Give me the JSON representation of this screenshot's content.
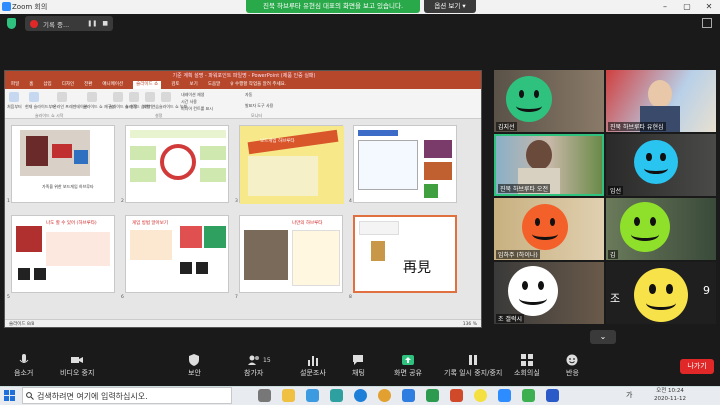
{
  "window": {
    "title": "Zoom 회의",
    "controls": [
      "–",
      "▢",
      "✕"
    ]
  },
  "share_banner": {
    "text": "진북 하브루타 유현심 대표의 화면을 보고 있습니다.",
    "view_options": "옵션 보기 ▾"
  },
  "meeting_header": {
    "recording_label": "기록 중...",
    "pause_icon": "❚❚",
    "stop_icon": "■"
  },
  "powerpoint": {
    "title": "기준 계획 설명 - 파워포인트 파일명 - PowerPoint (제품 인증 실패)",
    "tabs": [
      "파일",
      "홈",
      "삽입",
      "디자인",
      "전환",
      "애니메이션",
      "슬라이드 쇼",
      "검토",
      "보기",
      "도움말",
      "♀ 수행할 작업을 알려 주세요."
    ],
    "active_tab": "슬라이드 쇼",
    "ribbon_buttons": [
      "처음부터",
      "현재 슬라이드부터",
      "온라인 프레젠테이션",
      "슬라이드 쇼 재구성",
      "슬라이드 쇼 설정",
      "슬라이드 숨기기",
      "예행 연습",
      "슬라이드 쇼 녹화"
    ],
    "ribbon_checks": [
      "내레이션 재생",
      "시간 사용",
      "미디어 컨트롤 표시"
    ],
    "ribbon_groups": [
      "슬라이드 쇼 시작",
      "설정",
      "모니터"
    ],
    "monitor_select": "자동",
    "presenter_view": "발표자 도구 사용",
    "slide_numbers": [
      "1",
      "2",
      "3",
      "4",
      "5",
      "6",
      "7",
      "8"
    ],
    "selected_slide": "8",
    "slide_texts": {
      "s1_caption": "가족을 위한 보드게임 하브루타",
      "s3_title": "보드게임 하브루타",
      "s5_title": "나도 할 수 있어 (하브루타)",
      "s6_title": "게임 방법 알아보기",
      "s7_title": "나만의 하브루타",
      "s8_char": "再見"
    },
    "status_left": "슬라이드 8/8",
    "status_right": "136 %"
  },
  "participants": [
    {
      "name": "김지선",
      "smiley": "#2ec27e"
    },
    {
      "name": "진북 하브루타 유현심",
      "smiley": null
    },
    {
      "name": "진북 하브루타 오전",
      "smiley": null
    },
    {
      "name": "임선",
      "smiley": "#29c4f0"
    },
    {
      "name": "임하주 (하이나)",
      "smiley": "#f4602a"
    },
    {
      "name": "김",
      "smiley": "#8fe02a"
    },
    {
      "name": "조 갤럭시",
      "smiley": "#ffffff"
    },
    {
      "name": "조",
      "smiley": "#f8e24a"
    }
  ],
  "tile_number": "9",
  "grid_more": "⌄",
  "toolbar": {
    "items": [
      {
        "label": "음소거",
        "icon": "microphone-icon"
      },
      {
        "label": "비디오 중지",
        "icon": "video-icon"
      },
      {
        "label": "보안",
        "icon": "shield-icon"
      },
      {
        "label": "참가자",
        "icon": "participants-icon",
        "count": "15"
      },
      {
        "label": "설문조사",
        "icon": "poll-icon"
      },
      {
        "label": "채팅",
        "icon": "chat-icon"
      },
      {
        "label": "화면 공유",
        "icon": "share-screen-icon"
      },
      {
        "label": "기록 일시 중지/중지",
        "icon": "pause-record-icon"
      },
      {
        "label": "소회의실",
        "icon": "breakout-icon"
      },
      {
        "label": "반응",
        "icon": "reaction-icon"
      }
    ],
    "leave": "나가기"
  },
  "taskbar": {
    "search_placeholder": "검색하려면 여기에 입력하십시오.",
    "time": "오전 10:24",
    "date": "2020-11-12",
    "lang": "가"
  },
  "colors": {
    "share_green": "#2aa94a",
    "ppt_red": "#b7472a",
    "leave_red": "#e02828",
    "zoom_blue": "#2d8cff"
  }
}
